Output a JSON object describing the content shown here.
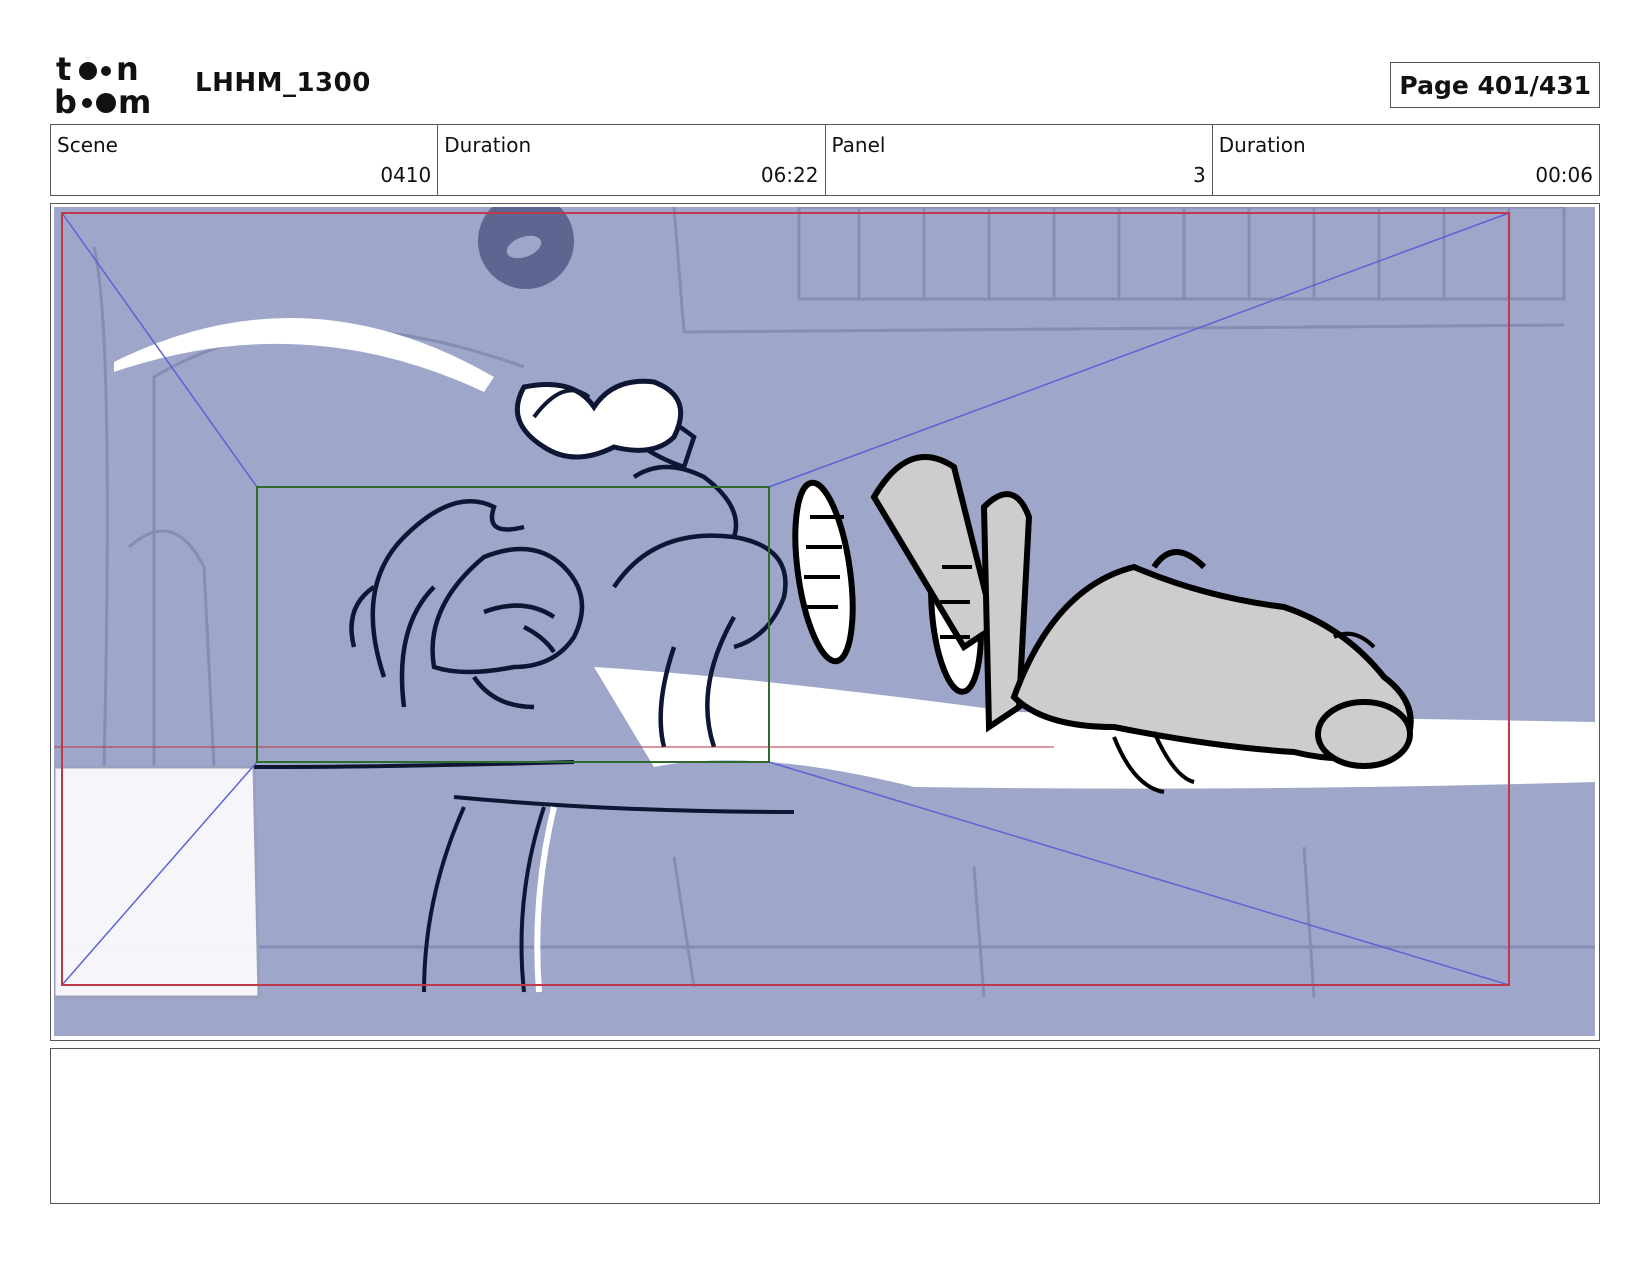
{
  "header": {
    "logo_text": "toon boom",
    "project_title": "LHHM_1300",
    "page_label": "Page 401/431"
  },
  "info": {
    "scene": {
      "label": "Scene",
      "value": "0410"
    },
    "scene_duration": {
      "label": "Duration",
      "value": "06:22"
    },
    "panel": {
      "label": "Panel",
      "value": "3"
    },
    "panel_duration": {
      "label": "Duration",
      "value": "00:06"
    }
  },
  "panel_image": {
    "icon": "storyboard-sketch",
    "background_color": "#9ea6c9",
    "safe_frame_color": "#c0394b",
    "camera_box_color": "#2f6b2f",
    "guide_line_color": "#5b63d6"
  },
  "notes": {
    "text": ""
  }
}
